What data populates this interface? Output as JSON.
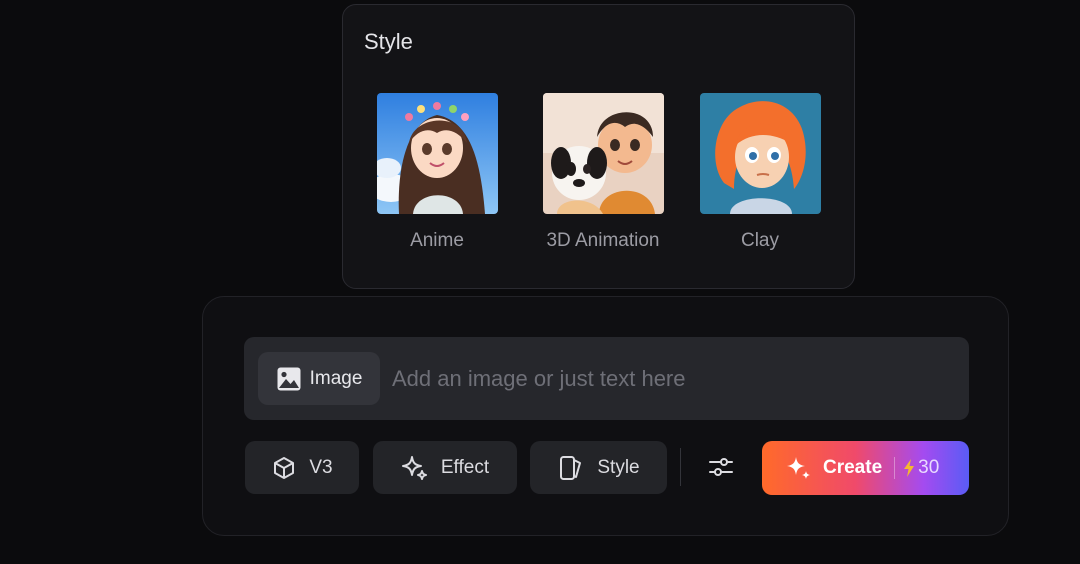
{
  "style_panel": {
    "title": "Style",
    "options": [
      {
        "label": "Anime"
      },
      {
        "label": "3D Animation"
      },
      {
        "label": "Clay"
      }
    ]
  },
  "composer": {
    "image_button_label": "Image",
    "prompt_placeholder": "Add an image or just text here",
    "prompt_value": "",
    "tools": {
      "model_label": "V3",
      "effect_label": "Effect",
      "style_label": "Style"
    },
    "create": {
      "label": "Create",
      "credits": "30"
    }
  },
  "colors": {
    "background": "#0b0b0d",
    "panel": "#131316",
    "button": "#232428",
    "create_gradient_start": "#ff6a2a",
    "create_gradient_end": "#5a5cf5",
    "credit_bolt": "#f5b82e"
  },
  "icons": {
    "image_button": "image-icon",
    "model": "cube-icon",
    "effect": "sparkle-icon",
    "style": "style-card-icon",
    "settings": "sliders-icon",
    "create": "sparkle-icon",
    "credits": "lightning-icon"
  }
}
